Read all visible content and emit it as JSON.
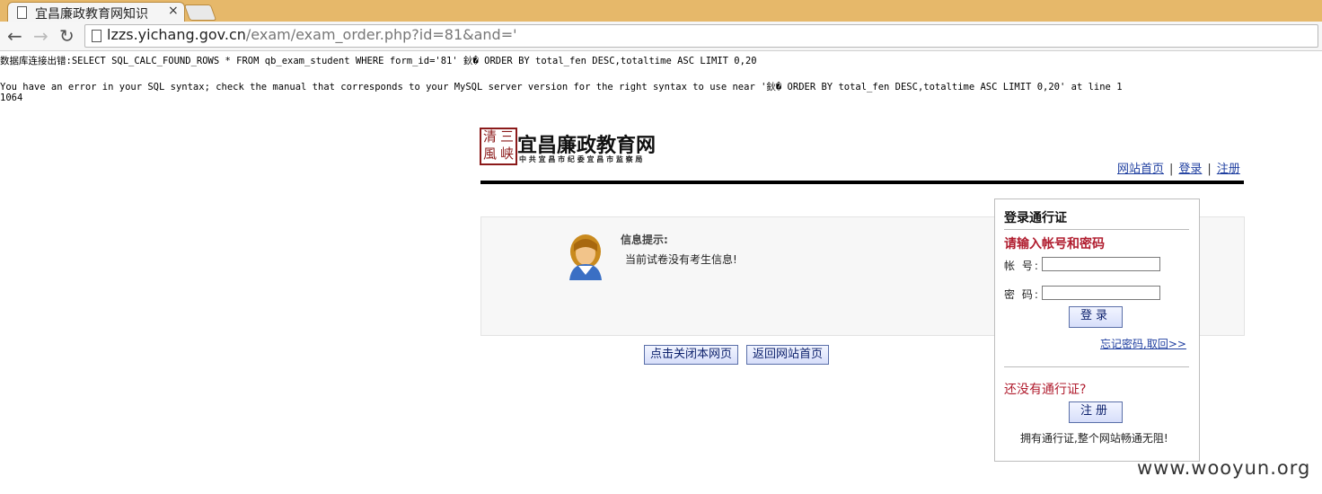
{
  "browser": {
    "tab_title": "宜昌廉政教育网知识",
    "close_glyph": "×",
    "url_host": "lzzs.yichang.gov.cn",
    "url_path": "/exam/exam_order.php?id=81&and='"
  },
  "error": {
    "line1": "数据库连接出错:SELECT SQL_CALC_FOUND_ROWS * FROM qb_exam_student WHERE form_id='81' 鈥� ORDER BY total_fen DESC,totaltime ASC LIMIT 0,20",
    "line2": "You have an error in your SQL syntax; check the manual that corresponds to your MySQL server version for the right syntax to use near '鈥� ORDER BY total_fen DESC,totaltime ASC LIMIT 0,20' at line 1",
    "code": "1064"
  },
  "site": {
    "logo_title": "宜昌廉政教育网",
    "logo_sub": "中 共 宜 昌 市 纪 委    宜 昌 市 监 察 局",
    "seal_chars": [
      "清",
      "三",
      "風",
      "峡"
    ],
    "nav": [
      "网站首页",
      "登录",
      "注册"
    ],
    "nav_sep": "|"
  },
  "message": {
    "heading": "信息提示:",
    "body": "当前试卷没有考生信息!",
    "btn_close": "点击关闭本网页",
    "btn_home": "返回网站首页"
  },
  "login": {
    "title": "登录通行证",
    "hint": "请输入帐号和密码",
    "account_label": "帐 号:",
    "password_label": "密 码:",
    "account_value": "",
    "password_value": "",
    "login_btn": "登录",
    "forgot": "忘记密码,取回>>",
    "no_account": "还没有通行证?",
    "register_btn": "注册",
    "footer": "拥有通行证,整个网站畅通无阻!"
  },
  "watermark": "www.wooyun.org"
}
